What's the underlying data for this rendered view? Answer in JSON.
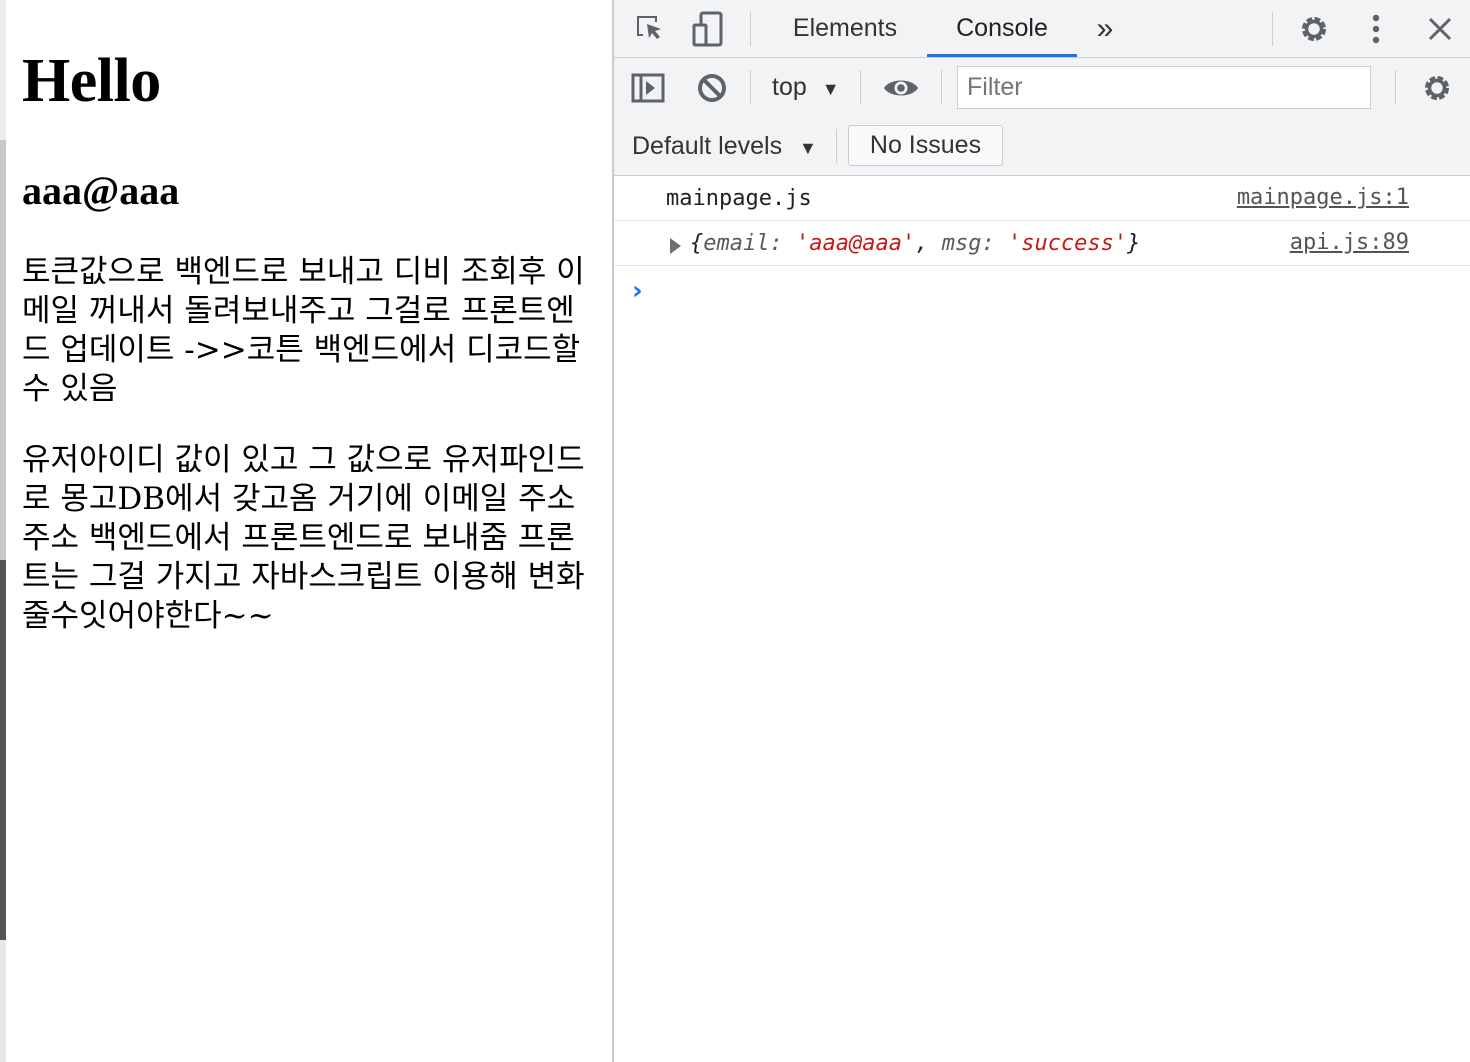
{
  "page": {
    "heading": "Hello",
    "email": "aaa@aaa",
    "paragraph1": "토큰값으로 백엔드로 보내고 디비 조회후 이메일 꺼내서 돌려보내주고 그걸로 프론트엔드 업데이트 ->>코튼 백엔드에서 디코드할 수 있음",
    "paragraph2": "유저아이디 값이 있고 그 값으로 유저파인드로 몽고DB에서 갖고옴 거기에 이메일 주소 주소 백엔드에서 프론트엔드로 보내줌 프론트는 그걸 가지고 자바스크립트 이용해 변화줄수잇어야한다~~"
  },
  "devtools": {
    "tabs": {
      "elements": "Elements",
      "console": "Console",
      "more": "»"
    },
    "context": "top",
    "filter_placeholder": "Filter",
    "levels": "Default levels",
    "issues": "No Issues",
    "logs": [
      {
        "message": "mainpage.js",
        "source": "mainpage.js:1"
      },
      {
        "source": "api.js:89",
        "object": {
          "open": "{",
          "k1": "email",
          "v1": "'aaa@aaa'",
          "k2": "msg",
          "v2": "'success'",
          "close": "}"
        }
      }
    ],
    "prompt": "›"
  },
  "colors": {
    "accent": "#1a73e8",
    "string": "#c41a16",
    "toolbar_bg": "#f1f3f4"
  },
  "icons": [
    "inspect-element-icon",
    "device-toolbar-icon",
    "gear-icon",
    "kebab-menu-icon",
    "close-icon",
    "sidebar-toggle-icon",
    "clear-console-icon",
    "eye-icon"
  ]
}
